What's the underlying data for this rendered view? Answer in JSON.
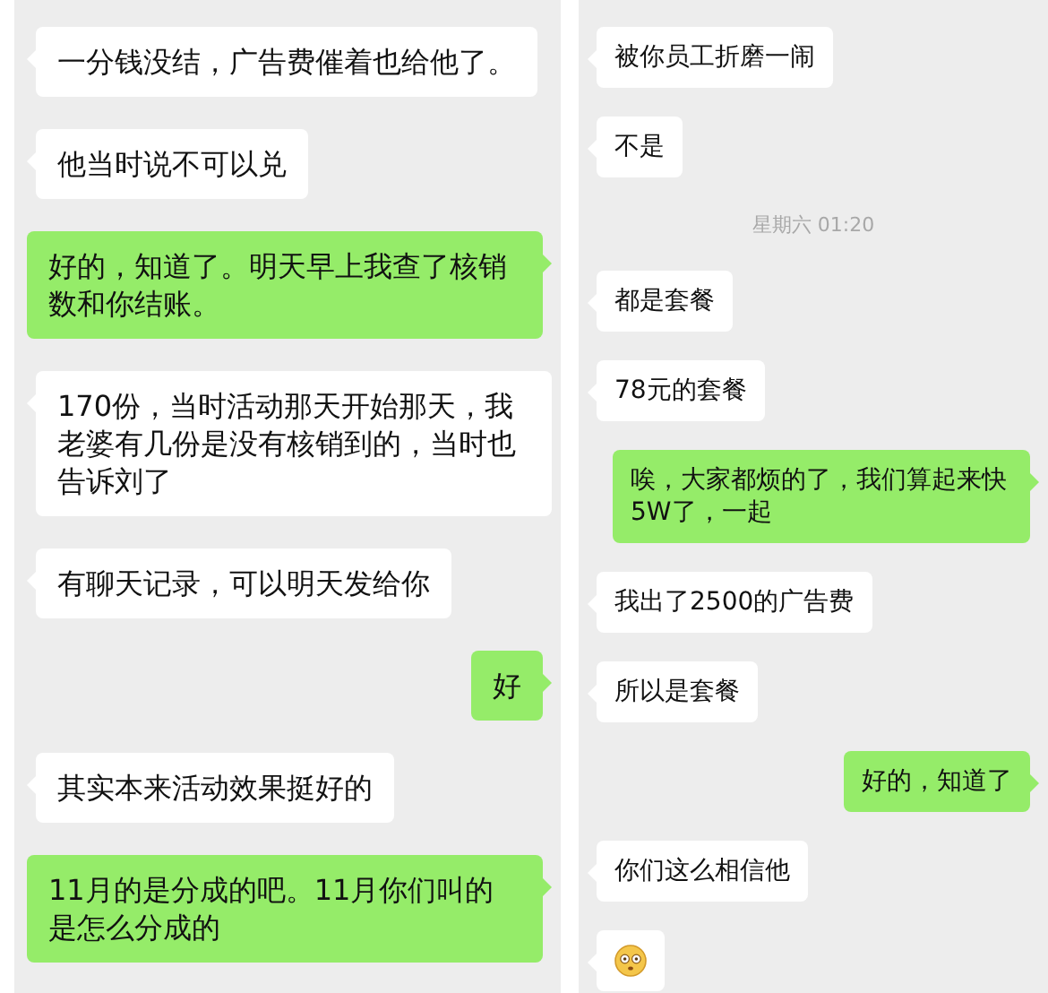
{
  "panels": [
    {
      "messages": [
        {
          "kind": "text",
          "outgoing": false,
          "text": "一分钱没结，广告费催着也给他了。"
        },
        {
          "kind": "text",
          "outgoing": false,
          "text": "他当时说不可以兑"
        },
        {
          "kind": "text",
          "outgoing": true,
          "text": "好的，知道了。明天早上我查了核销数和你结账。"
        },
        {
          "kind": "text",
          "outgoing": false,
          "text": "170份，当时活动那天开始那天，我老婆有几份是没有核销到的，当时也告诉刘了"
        },
        {
          "kind": "text",
          "outgoing": false,
          "text": "有聊天记录，可以明天发给你"
        },
        {
          "kind": "text",
          "outgoing": true,
          "text": "好"
        },
        {
          "kind": "text",
          "outgoing": false,
          "text": "其实本来活动效果挺好的"
        },
        {
          "kind": "text",
          "outgoing": true,
          "text": "11月的是分成的吧。11月你们叫的是怎么分成的"
        }
      ]
    },
    {
      "messages": [
        {
          "kind": "text",
          "outgoing": false,
          "text": "被你员工折磨一闹"
        },
        {
          "kind": "text",
          "outgoing": false,
          "text": "不是"
        },
        {
          "kind": "time",
          "text": "星期六 01:20"
        },
        {
          "kind": "text",
          "outgoing": false,
          "text": "都是套餐"
        },
        {
          "kind": "text",
          "outgoing": false,
          "text": "78元的套餐"
        },
        {
          "kind": "text",
          "outgoing": true,
          "text": "唉，大家都烦的了，我们算起来快5W了，一起"
        },
        {
          "kind": "text",
          "outgoing": false,
          "text": "我出了2500的广告费"
        },
        {
          "kind": "text",
          "outgoing": false,
          "text": "所以是套餐"
        },
        {
          "kind": "text",
          "outgoing": true,
          "text": "好的，知道了"
        },
        {
          "kind": "text",
          "outgoing": false,
          "text": "你们这么相信他"
        },
        {
          "kind": "emoji",
          "outgoing": false
        }
      ]
    }
  ]
}
